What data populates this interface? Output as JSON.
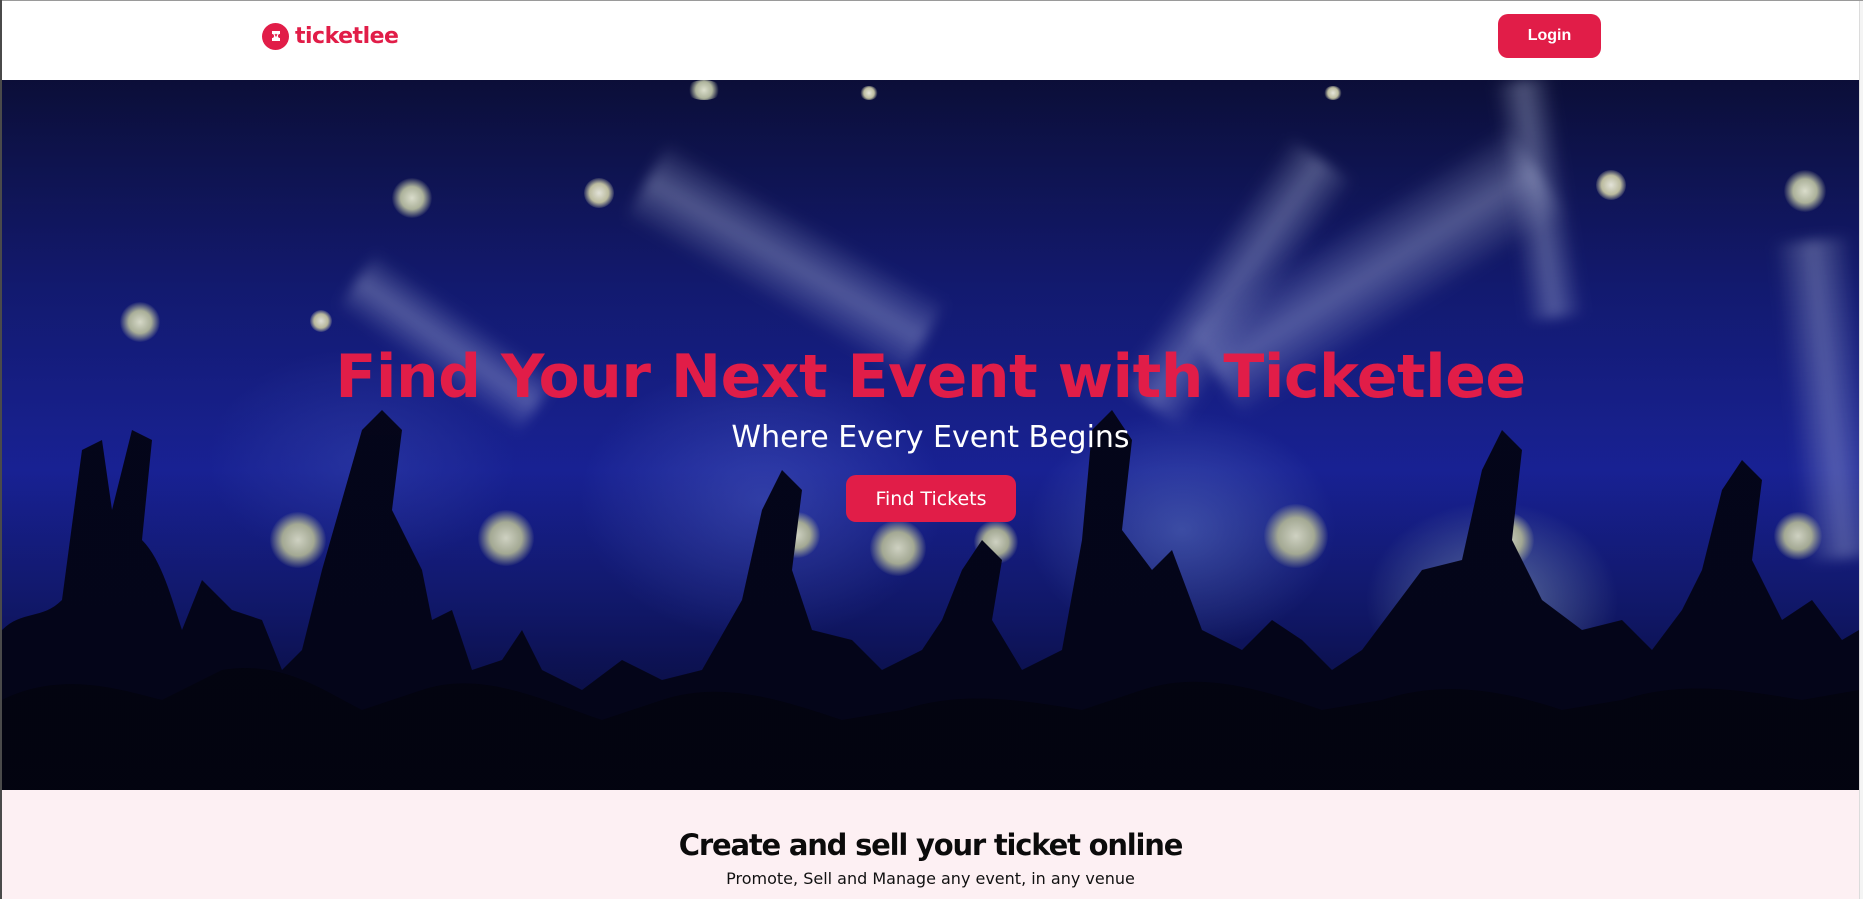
{
  "header": {
    "logo_text": "ticketlee",
    "logo_icon": "ticket-icon",
    "login_label": "Login"
  },
  "hero": {
    "title": "Find Your Next Event with Ticketlee",
    "subtitle": "Where Every Event Begins",
    "cta_label": "Find Tickets"
  },
  "promo": {
    "title": "Create and sell your ticket online",
    "subtitle": "Promote, Sell and Manage any event, in any venue"
  },
  "colors": {
    "brand": "#e11d48",
    "promo_background": "#fdf0f3",
    "hero_blue": "#1b25a2"
  }
}
